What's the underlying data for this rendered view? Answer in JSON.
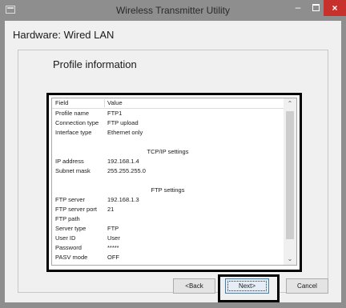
{
  "window": {
    "title": "Wireless Transmitter Utility",
    "minimize_glyph": "–",
    "close_glyph": "×",
    "icon": "app-icon"
  },
  "page": {
    "heading": "Hardware: Wired LAN",
    "panel_title": "Profile information"
  },
  "list": {
    "columns": [
      "Field",
      "Value"
    ],
    "rows": [
      {
        "field": "Profile name",
        "value": "FTP1"
      },
      {
        "field": "Connection type",
        "value": "FTP upload"
      },
      {
        "field": "Interface type",
        "value": "Ethernet only"
      }
    ],
    "section_tcpip": "TCP/IP settings",
    "tcpip_rows": [
      {
        "field": "IP address",
        "value": "192.168.1.4"
      },
      {
        "field": "Subnet mask",
        "value": "255.255.255.0"
      }
    ],
    "section_ftp": "FTP settings",
    "ftp_rows": [
      {
        "field": "FTP server",
        "value": "192.168.1.3"
      },
      {
        "field": "FTP server port",
        "value": "21"
      },
      {
        "field": "FTP path",
        "value": ""
      },
      {
        "field": "Server type",
        "value": "FTP"
      },
      {
        "field": "User ID",
        "value": "User"
      },
      {
        "field": "Password",
        "value": "*****"
      },
      {
        "field": "PASV mode",
        "value": "OFF"
      }
    ],
    "scroll_up_icon": "chevron-up-icon",
    "scroll_down_icon": "chevron-down-icon"
  },
  "buttons": {
    "back": "<Back",
    "next": "Next>",
    "cancel": "Cancel"
  }
}
